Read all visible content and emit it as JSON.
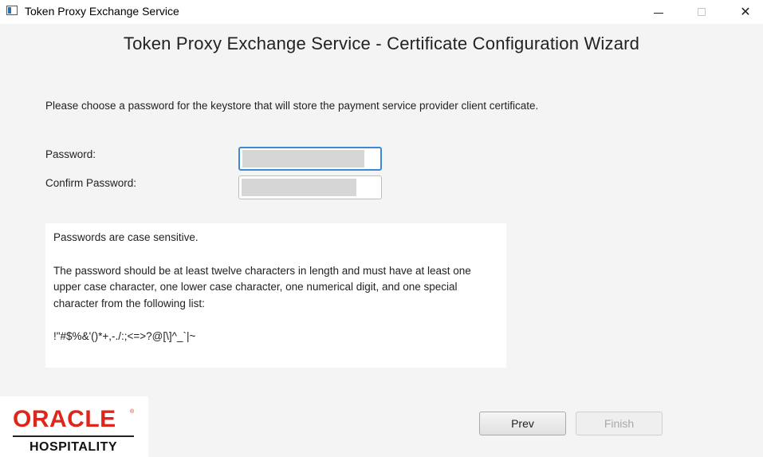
{
  "window": {
    "title": "Token Proxy Exchange Service",
    "controls": {
      "minimize_icon": "minimize-icon",
      "maximize_icon": "maximize-icon",
      "close_icon": "close-icon",
      "close_glyph": "✕"
    }
  },
  "wizard": {
    "heading": "Token Proxy Exchange Service - Certificate Configuration Wizard",
    "instructions": "Please choose a password for the keystore that will store the payment service provider client certificate.",
    "form": {
      "password_label": "Password:",
      "confirm_password_label": "Confirm Password:"
    },
    "info": {
      "line1": "Passwords are case sensitive.",
      "line2": "The password should be at least twelve characters in length and must have at least one upper case character, one lower case character, one numerical digit, and one special character from the following list:",
      "line3": "!\"#$%&'()*+,-./:;<=>?@[\\]^_`|~"
    },
    "buttons": {
      "prev": "Prev",
      "finish": "Finish"
    }
  },
  "logo": {
    "brand": "ORACLE",
    "registered": "®",
    "sub": "HOSPITALITY"
  },
  "colors": {
    "focus_border": "#3b8ad8",
    "oracle_red": "#e0261b",
    "background": "#f4f4f4"
  }
}
